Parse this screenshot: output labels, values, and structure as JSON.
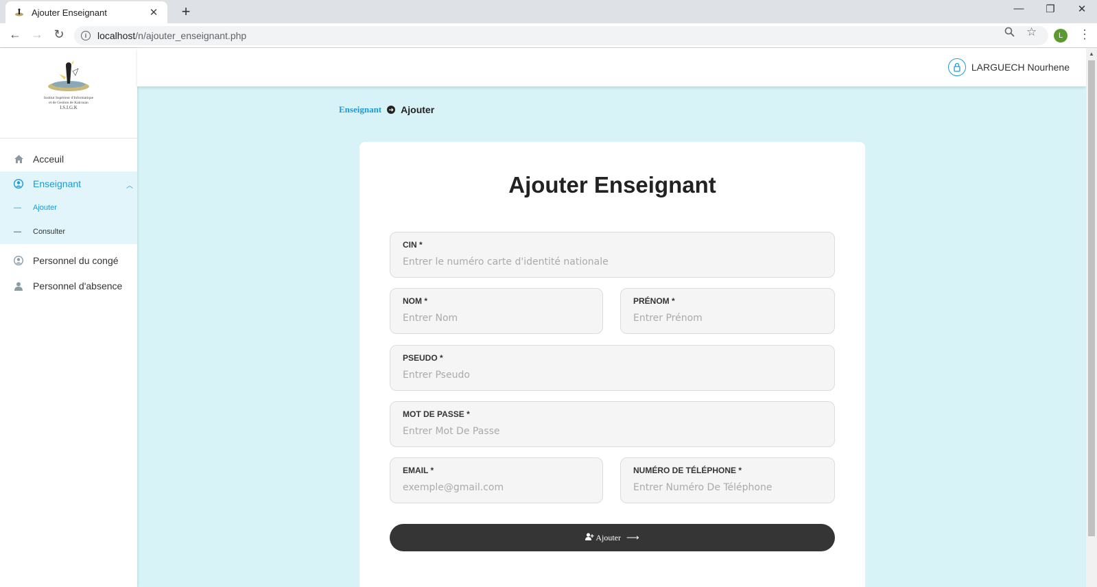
{
  "browser": {
    "tab_title": "Ajouter Enseignant",
    "url_host": "localhost",
    "url_path": "/n/ajouter_enseignant.php",
    "profile_initial": "L"
  },
  "sidebar": {
    "logo_line1": "Institut Supérieur d'Informatique",
    "logo_line2": "et de Gestion de Kairouan",
    "logo_line3": "I.S.I.G.K",
    "items": [
      {
        "label": "Acceuil",
        "icon": "home-icon"
      },
      {
        "label": "Enseignant",
        "icon": "user-circle-icon",
        "active": true
      },
      {
        "label": "Personnel du congé",
        "icon": "user-circle-icon"
      },
      {
        "label": "Personnel d'absence",
        "icon": "user-icon"
      }
    ],
    "submenu": [
      {
        "label": "Ajouter",
        "active": true
      },
      {
        "label": "Consulter"
      }
    ],
    "submenu_dash": "—"
  },
  "header": {
    "user_name": "LARGUECH Nourhene"
  },
  "breadcrumb": {
    "parent": "Enseignant",
    "current": "Ajouter"
  },
  "form": {
    "title": "Ajouter Enseignant",
    "fields": {
      "cin": {
        "label": "CIN *",
        "placeholder": "Entrer le numéro carte d'identité nationale"
      },
      "nom": {
        "label": "NOM *",
        "placeholder": "Entrer Nom"
      },
      "prenom": {
        "label": "PRÉNOM *",
        "placeholder": "Entrer Prénom"
      },
      "pseudo": {
        "label": "PSEUDO *",
        "placeholder": "Entrer Pseudo"
      },
      "password": {
        "label": "MOT DE PASSE *",
        "placeholder": "Entrer Mot De Passe"
      },
      "email": {
        "label": "EMAIL *",
        "placeholder": "exemple@gmail.com"
      },
      "phone": {
        "label": "NUMÉRO DE TÉLÉPHONE *",
        "placeholder": "Entrer Numéro De Téléphone"
      }
    },
    "submit_label": "Ajouter"
  },
  "colors": {
    "accent": "#1a9ad6",
    "page_bg": "#d7f3f7",
    "button_bg": "#353535"
  }
}
